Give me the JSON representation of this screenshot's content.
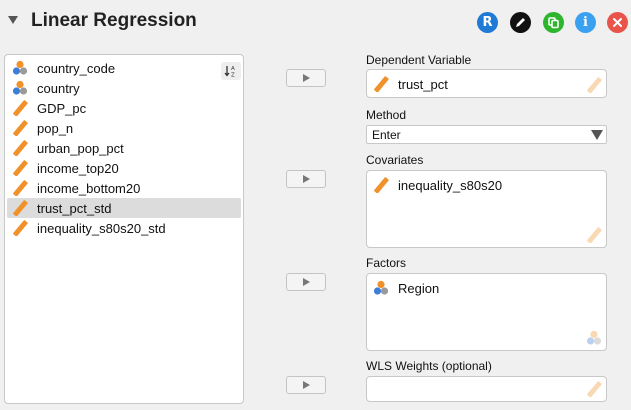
{
  "header": {
    "title": "Linear Regression",
    "r_button_label": "R",
    "info_button_label": "i",
    "colors": {
      "r": "#1e7ad4",
      "edit": "#111111",
      "duplicate": "#2db52d",
      "info": "#3aa0f0",
      "close": "#e8534a"
    }
  },
  "source": {
    "variables": [
      {
        "name": "country_code",
        "type": "nominal-text"
      },
      {
        "name": "country",
        "type": "nominal-text"
      },
      {
        "name": "GDP_pc",
        "type": "scale"
      },
      {
        "name": "pop_n",
        "type": "scale"
      },
      {
        "name": "urban_pop_pct",
        "type": "scale"
      },
      {
        "name": "income_top20",
        "type": "scale"
      },
      {
        "name": "income_bottom20",
        "type": "scale"
      },
      {
        "name": "trust_pct_std",
        "type": "scale",
        "selected": true
      },
      {
        "name": "inequality_s80s20_std",
        "type": "scale"
      }
    ]
  },
  "dependent": {
    "label": "Dependent Variable",
    "value": "trust_pct"
  },
  "method": {
    "label": "Method",
    "selected": "Enter"
  },
  "covariates": {
    "label": "Covariates",
    "items": [
      "inequality_s80s20"
    ]
  },
  "factors": {
    "label": "Factors",
    "items": [
      "Region"
    ]
  },
  "wls": {
    "label": "WLS Weights (optional)"
  },
  "icons": {
    "scale": "ruler-icon",
    "nominal": "nominal-icon",
    "sort": "sort-az-icon",
    "edit": "pencil-icon",
    "duplicate": "copy-icon",
    "close": "close-icon"
  }
}
